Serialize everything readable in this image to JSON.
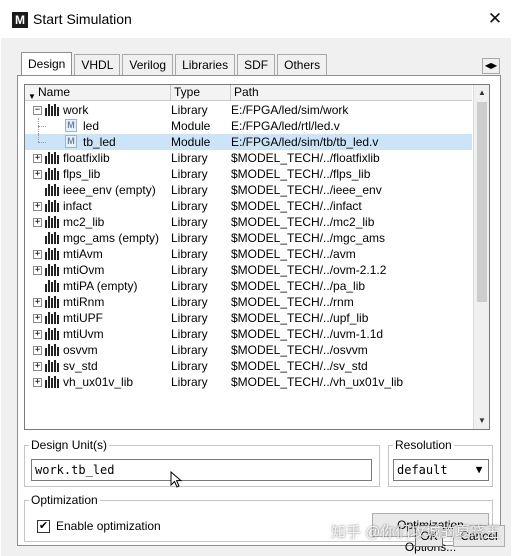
{
  "window": {
    "title": "Start Simulation",
    "app_icon_letter": "M"
  },
  "tabs": [
    {
      "label": "Design",
      "active": true
    },
    {
      "label": "VHDL",
      "active": false
    },
    {
      "label": "Verilog",
      "active": false
    },
    {
      "label": "Libraries",
      "active": false
    },
    {
      "label": "SDF",
      "active": false
    },
    {
      "label": "Others",
      "active": false
    }
  ],
  "table": {
    "columns": [
      "Name",
      "Type",
      "Path"
    ],
    "rows": [
      {
        "name": "work",
        "type": "Library",
        "path": "E:/FPGA/led/sim/work",
        "kind": "library",
        "level": 0,
        "expander": "-"
      },
      {
        "name": "led",
        "type": "Module",
        "path": "E:/FPGA/led/rtl/led.v",
        "kind": "module",
        "level": 1,
        "expander": ""
      },
      {
        "name": "tb_led",
        "type": "Module",
        "path": "E:/FPGA/led/sim/tb/tb_led.v",
        "kind": "module",
        "level": 1,
        "expander": "",
        "selected": true
      },
      {
        "name": "floatfixlib",
        "type": "Library",
        "path": "$MODEL_TECH/../floatfixlib",
        "kind": "library",
        "level": 0,
        "expander": "+"
      },
      {
        "name": "flps_lib",
        "type": "Library",
        "path": "$MODEL_TECH/../flps_lib",
        "kind": "library",
        "level": 0,
        "expander": "+"
      },
      {
        "name": "ieee_env  (empty)",
        "type": "Library",
        "path": "$MODEL_TECH/../ieee_env",
        "kind": "library",
        "level": 0,
        "expander": ""
      },
      {
        "name": "infact",
        "type": "Library",
        "path": "$MODEL_TECH/../infact",
        "kind": "library",
        "level": 0,
        "expander": "+"
      },
      {
        "name": "mc2_lib",
        "type": "Library",
        "path": "$MODEL_TECH/../mc2_lib",
        "kind": "library",
        "level": 0,
        "expander": "+"
      },
      {
        "name": "mgc_ams  (empty)",
        "type": "Library",
        "path": "$MODEL_TECH/../mgc_ams",
        "kind": "library",
        "level": 0,
        "expander": ""
      },
      {
        "name": "mtiAvm",
        "type": "Library",
        "path": "$MODEL_TECH/../avm",
        "kind": "library",
        "level": 0,
        "expander": "+"
      },
      {
        "name": "mtiOvm",
        "type": "Library",
        "path": "$MODEL_TECH/../ovm-2.1.2",
        "kind": "library",
        "level": 0,
        "expander": "+"
      },
      {
        "name": "mtiPA  (empty)",
        "type": "Library",
        "path": "$MODEL_TECH/../pa_lib",
        "kind": "library",
        "level": 0,
        "expander": ""
      },
      {
        "name": "mtiRnm",
        "type": "Library",
        "path": "$MODEL_TECH/../rnm",
        "kind": "library",
        "level": 0,
        "expander": "+"
      },
      {
        "name": "mtiUPF",
        "type": "Library",
        "path": "$MODEL_TECH/../upf_lib",
        "kind": "library",
        "level": 0,
        "expander": "+"
      },
      {
        "name": "mtiUvm",
        "type": "Library",
        "path": "$MODEL_TECH/../uvm-1.1d",
        "kind": "library",
        "level": 0,
        "expander": "+"
      },
      {
        "name": "osvvm",
        "type": "Library",
        "path": "$MODEL_TECH/../osvvm",
        "kind": "library",
        "level": 0,
        "expander": "+"
      },
      {
        "name": "sv_std",
        "type": "Library",
        "path": "$MODEL_TECH/../sv_std",
        "kind": "library",
        "level": 0,
        "expander": "+"
      },
      {
        "name": "vh_ux01v_lib",
        "type": "Library",
        "path": "$MODEL_TECH/../vh_ux01v_lib",
        "kind": "library",
        "level": 0,
        "expander": "+"
      }
    ]
  },
  "design_unit": {
    "label": "Design Unit(s)",
    "value": "work.tb_led"
  },
  "resolution": {
    "label": "Resolution",
    "value": "default"
  },
  "optimization": {
    "label": "Optimization",
    "enable_label": "Enable optimization",
    "enabled": true,
    "options_button": "Optimization Options..."
  },
  "buttons": {
    "ok": "OK",
    "cancel": "Cancel"
  },
  "watermark": "知乎 @你们攻城的夏晓王"
}
